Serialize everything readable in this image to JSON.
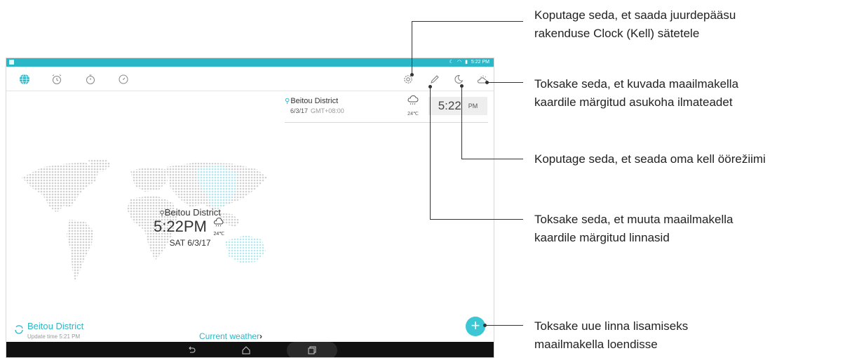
{
  "statusbar": {
    "time": "5:22 PM"
  },
  "tabs": [
    {
      "name": "world-clock",
      "icon": "globe-icon",
      "active": true
    },
    {
      "name": "alarm",
      "icon": "alarm-clock-icon",
      "active": false
    },
    {
      "name": "stopwatch",
      "icon": "stopwatch-icon",
      "active": false
    },
    {
      "name": "timer",
      "icon": "timer-icon",
      "active": false
    }
  ],
  "actions": [
    "settings-icon",
    "edit-pencil-icon",
    "night-mode-moon-icon",
    "weather-icon"
  ],
  "city_card": {
    "city": "Beitou District",
    "date": "6/3/17",
    "gmt": "GMT+08:00",
    "temp": "24℃",
    "time": "5:22",
    "ampm": "PM"
  },
  "map_overlay": {
    "city": "Beitou District",
    "time": "5:22PM",
    "temp": "24℃",
    "date": "SAT 6/3/17"
  },
  "bottom": {
    "city": "Beitou District",
    "update": "Update time 5:21 PM",
    "current_weather": "Current weather"
  },
  "callouts": {
    "settings_1": "Koputage seda, et saada juurdepääsu",
    "settings_2": "rakenduse Clock (Kell) sätetele",
    "weather_1": "Toksake seda, et kuvada maailmakella",
    "weather_2": "kaardile märgitud asukoha ilmateadet",
    "night": "Koputage seda, et seada oma kell öörežiimi",
    "edit_1": "Toksake seda, et muuta maailmakella",
    "edit_2": "kaardile märgitud linnasid",
    "add_1": "Toksake uue linna lisamiseks",
    "add_2": "maailmakella loendisse"
  },
  "colors": {
    "accent": "#2ab7c8",
    "map_dots": "#d0d0d0",
    "map_highlight": "#b5e9ee"
  }
}
